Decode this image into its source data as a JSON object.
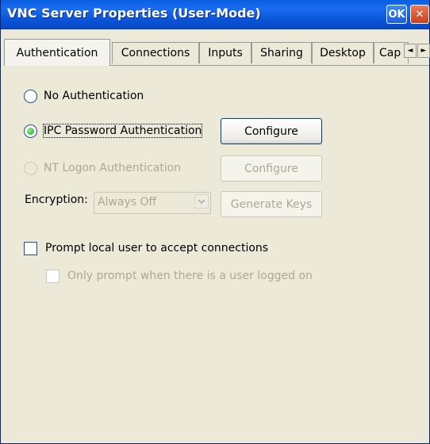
{
  "window": {
    "title": "VNC Server Properties (User-Mode)",
    "ok_label": "OK",
    "close_label": "✕"
  },
  "tabs": [
    {
      "label": "Authentication",
      "active": true
    },
    {
      "label": "Connections",
      "active": false
    },
    {
      "label": "Inputs",
      "active": false
    },
    {
      "label": "Sharing",
      "active": false
    },
    {
      "label": "Desktop",
      "active": false
    },
    {
      "label": "Cap",
      "active": false
    }
  ],
  "tab_scroll": {
    "left": "◄",
    "right": "►"
  },
  "auth": {
    "no_auth_label": "No Authentication",
    "ipc_label": "IPC Password Authentication",
    "ipc_selected": true,
    "ipc_configure": "Configure",
    "nt_label": "NT Logon Authentication",
    "nt_configure": "Configure",
    "encryption_label": "Encryption:",
    "encryption_value": "Always Off",
    "generate_keys": "Generate Keys"
  },
  "prompt": {
    "accept_label": "Prompt local user to accept connections",
    "accept_checked": false,
    "logged_on_label": "Only prompt when there is a user logged on",
    "logged_on_checked": false
  }
}
